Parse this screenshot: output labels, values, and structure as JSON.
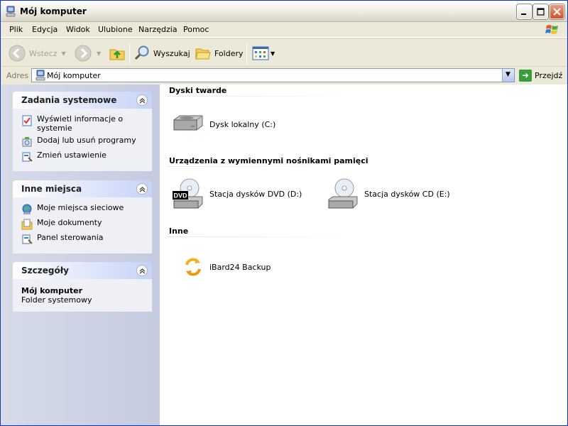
{
  "window": {
    "title": "Mój komputer"
  },
  "menu": [
    "Plik",
    "Edycja",
    "Widok",
    "Ulubione",
    "Narzędzia",
    "Pomoc"
  ],
  "toolbar": {
    "back": "Wstecz",
    "search": "Wyszukaj",
    "folders": "Foldery"
  },
  "address": {
    "label": "Adres",
    "value": "Mój komputer",
    "go": "Przejdź"
  },
  "left": {
    "system_tasks": {
      "title": "Zadania systemowe",
      "items": [
        "Wyświetl informacje o systemie",
        "Dodaj lub usuń programy",
        "Zmień ustawienie"
      ]
    },
    "other_places": {
      "title": "Inne miejsca",
      "items": [
        "Moje miejsca sieciowe",
        "Moje dokumenty",
        "Panel sterowania"
      ]
    },
    "details": {
      "title": "Szczegóły",
      "name": "Mój komputer",
      "type": "Folder systemowy"
    }
  },
  "groups": {
    "hard_drives": {
      "title": "Dyski twarde",
      "items": [
        "Dysk lokalny (C:)"
      ]
    },
    "removable": {
      "title": "Urządzenia z wymiennymi nośnikami pamięci",
      "items": [
        "Stacja dysków DVD (D:)",
        "Stacja dysków CD (E:)"
      ]
    },
    "other": {
      "title": "Inne",
      "items": [
        "iBard24 Backup"
      ]
    }
  },
  "icons": {
    "title": "my-computer-icon",
    "dvd_badge": "DVD"
  }
}
